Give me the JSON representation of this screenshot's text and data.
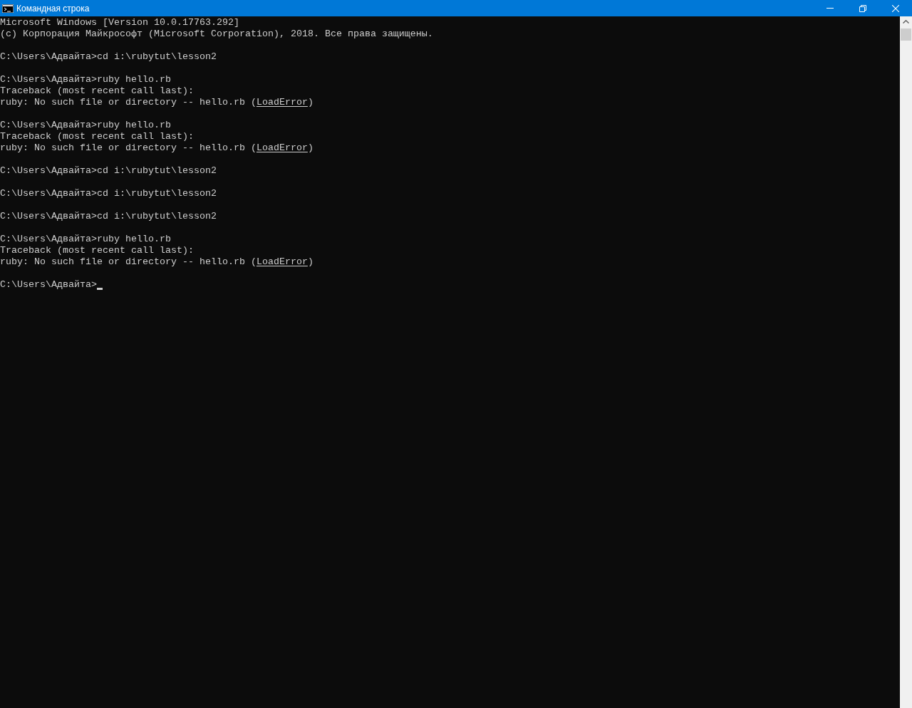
{
  "window": {
    "title": "Командная строка"
  },
  "console": {
    "blocks": [
      [
        {
          "parts": [
            {
              "kind": "text",
              "text": "Microsoft Windows [Version 10.0.17763.292]"
            }
          ]
        },
        {
          "parts": [
            {
              "kind": "text",
              "text": "(c) Корпорация Майкрософт (Microsoft Corporation), 2018. Все права защищены."
            }
          ]
        }
      ],
      [
        {
          "parts": [
            {
              "kind": "text",
              "text": "C:\\Users\\Адвайта>cd i:\\rubytut\\lesson2"
            }
          ]
        }
      ],
      [
        {
          "parts": [
            {
              "kind": "text",
              "text": "C:\\Users\\Адвайта>ruby hello.rb"
            }
          ]
        },
        {
          "parts": [
            {
              "kind": "text",
              "text": "Traceback (most recent call last):"
            }
          ]
        },
        {
          "parts": [
            {
              "kind": "text",
              "text": "ruby: No such file or directory -- hello.rb ("
            },
            {
              "kind": "underlined",
              "text": "LoadError"
            },
            {
              "kind": "text",
              "text": ")"
            }
          ]
        }
      ],
      [
        {
          "parts": [
            {
              "kind": "text",
              "text": "C:\\Users\\Адвайта>ruby hello.rb"
            }
          ]
        },
        {
          "parts": [
            {
              "kind": "text",
              "text": "Traceback (most recent call last):"
            }
          ]
        },
        {
          "parts": [
            {
              "kind": "text",
              "text": "ruby: No such file or directory -- hello.rb ("
            },
            {
              "kind": "underlined",
              "text": "LoadError"
            },
            {
              "kind": "text",
              "text": ")"
            }
          ]
        }
      ],
      [
        {
          "parts": [
            {
              "kind": "text",
              "text": "C:\\Users\\Адвайта>cd i:\\rubytut\\lesson2"
            }
          ]
        }
      ],
      [
        {
          "parts": [
            {
              "kind": "text",
              "text": "C:\\Users\\Адвайта>cd i:\\rubytut\\lesson2"
            }
          ]
        }
      ],
      [
        {
          "parts": [
            {
              "kind": "text",
              "text": "C:\\Users\\Адвайта>cd i:\\rubytut\\lesson2"
            }
          ]
        }
      ],
      [
        {
          "parts": [
            {
              "kind": "text",
              "text": "C:\\Users\\Адвайта>ruby hello.rb"
            }
          ]
        },
        {
          "parts": [
            {
              "kind": "text",
              "text": "Traceback (most recent call last):"
            }
          ]
        },
        {
          "parts": [
            {
              "kind": "text",
              "text": "ruby: No such file or directory -- hello.rb ("
            },
            {
              "kind": "underlined",
              "text": "LoadError"
            },
            {
              "kind": "text",
              "text": ")"
            }
          ]
        }
      ]
    ],
    "prompt": "C:\\Users\\Адвайта>",
    "cursor": true
  }
}
